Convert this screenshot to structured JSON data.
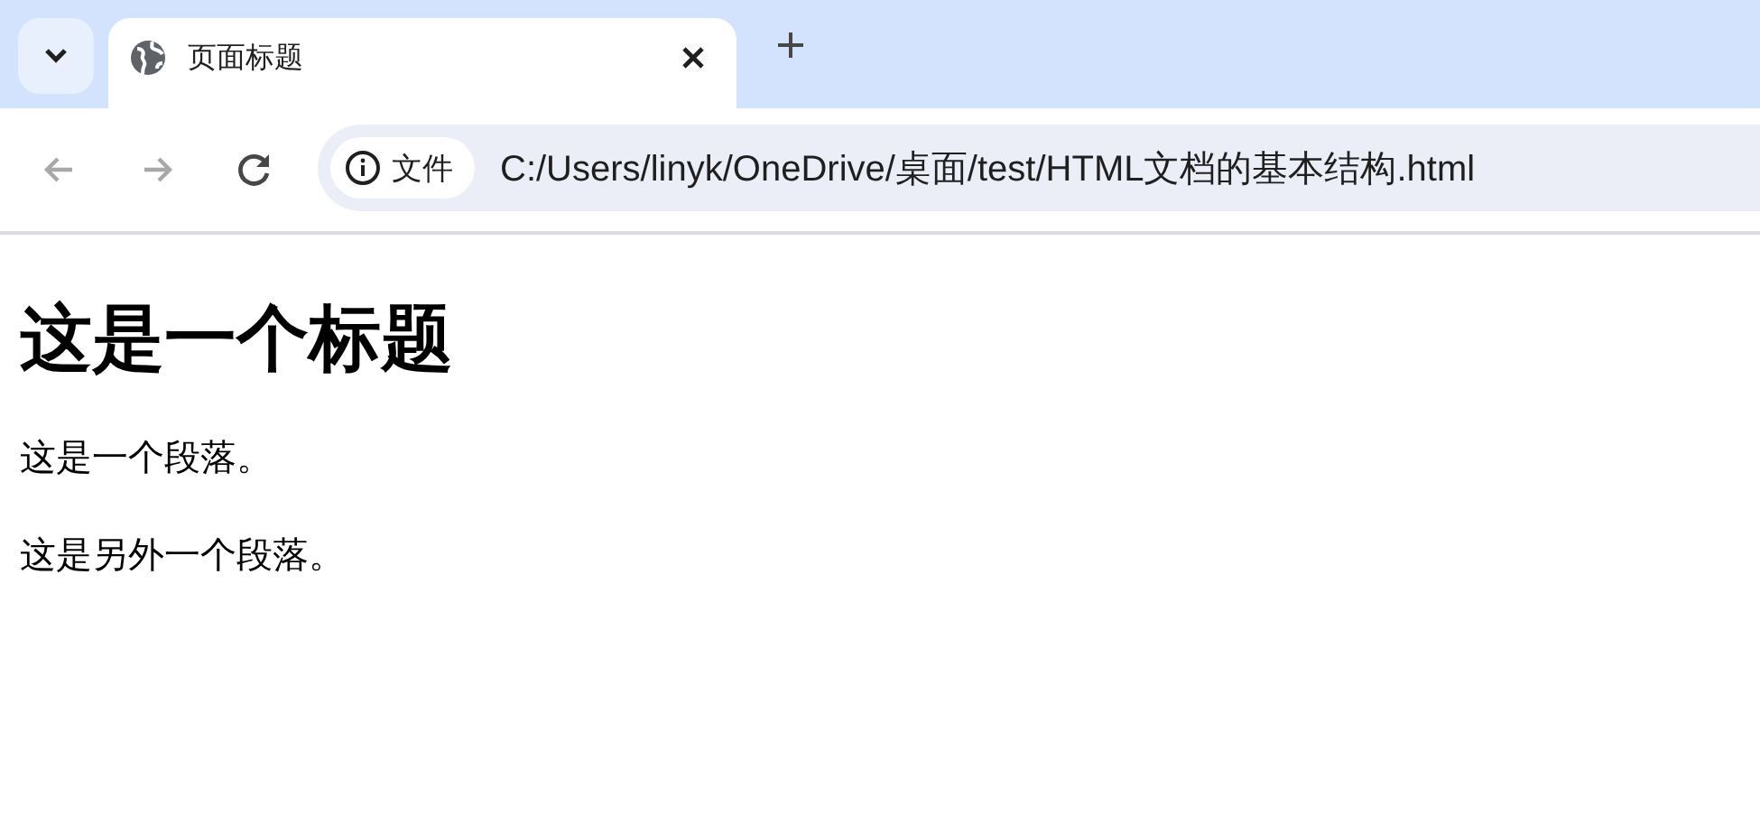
{
  "tabs": [
    {
      "title": "页面标题",
      "selected": true
    }
  ],
  "toolbar": {
    "nav_buttons": [
      {
        "kind": "back",
        "disabled": true
      },
      {
        "kind": "forward",
        "disabled": true
      },
      {
        "kind": "reload",
        "disabled": false
      }
    ],
    "security_chip": "文件",
    "url": "C:/Users/linyk/OneDrive/桌面/test/HTML文档的基本结构.html"
  },
  "page": {
    "heading": "这是一个标题",
    "paragraphs": [
      "这是一个段落。",
      "这是另外一个段落。"
    ]
  }
}
